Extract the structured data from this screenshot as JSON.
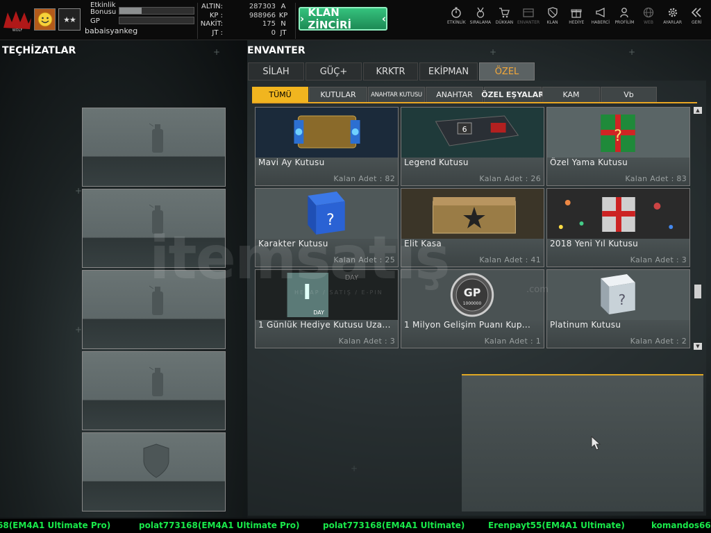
{
  "topbar": {
    "stat_labels": [
      "Etkinlik",
      "Bonusu",
      "GP"
    ],
    "username": "babaisyankeg",
    "bonus_progress": 0.3,
    "gp_progress": 0.0,
    "currency": [
      {
        "label": "ALTIN:",
        "value": "287303",
        "unit": "A"
      },
      {
        "label": "KP :",
        "value": "988966",
        "unit": "KP"
      },
      {
        "label": "NAKİT:",
        "value": "175",
        "unit": "N"
      },
      {
        "label": "JT :",
        "value": "0",
        "unit": "JT"
      }
    ],
    "klan_button": "KLAN ZİNCİRİ",
    "nav": [
      {
        "label": "ETKİNLİK",
        "icon": "stopwatch-icon"
      },
      {
        "label": "SIRALAMA",
        "icon": "medal-icon"
      },
      {
        "label": "DÜKKAN",
        "icon": "cart-icon"
      },
      {
        "label": "ENVANTER",
        "icon": "inventory-icon"
      },
      {
        "label": "KLAN",
        "icon": "shield-icon"
      },
      {
        "label": "HEDİYE",
        "icon": "gift-icon"
      },
      {
        "label": "HABERCİ",
        "icon": "megaphone-icon"
      },
      {
        "label": "PROFİLİM",
        "icon": "profile-icon"
      },
      {
        "label": "WEB",
        "icon": "globe-icon"
      },
      {
        "label": "AYARLAR",
        "icon": "gear-icon"
      },
      {
        "label": "GERİ",
        "icon": "back-icon"
      }
    ]
  },
  "left": {
    "title": "TEÇHİZATLAR"
  },
  "inventory": {
    "title": "ENVANTER",
    "tabs": [
      "SİLAH",
      "GÜÇ+",
      "KRKTR",
      "EKİPMAN",
      "ÖZEL"
    ],
    "active_tab": "ÖZEL",
    "subtabs": [
      "TÜMÜ",
      "KUTULAR",
      "ANAHTAR KUTUSU",
      "ANAHTAR",
      "ÖZEL EŞYALAR",
      "KAM",
      "Vb"
    ],
    "active_subtab": "TÜMÜ",
    "items": [
      {
        "name": "Mavi Ay Kutusu",
        "count": "Kalan Adet : 82"
      },
      {
        "name": "Legend Kutusu",
        "count": "Kalan Adet : 26"
      },
      {
        "name": "Özel Yama Kutusu",
        "count": "Kalan Adet : 83"
      },
      {
        "name": "Karakter Kutusu",
        "count": "Kalan Adet : 25"
      },
      {
        "name": "Elit Kasa",
        "count": "Kalan Adet : 41"
      },
      {
        "name": "2018 Yeni Yıl Kutusu",
        "count": "Kalan Adet : 3"
      },
      {
        "name": "1 Günlük Hediye Kutusu Uza...",
        "count": "Kalan Adet : 3"
      },
      {
        "name": "1 Milyon Gelişim Puanı Kup...",
        "count": "Kalan Adet : 1"
      },
      {
        "name": "Platinum Kutusu",
        "count": "Kalan Adet : 2"
      }
    ],
    "item_art": {
      "day_top": "DAY",
      "day_bottom": "DAY",
      "day_number": "1",
      "gp_label": "GP",
      "gp_amount": "1000000"
    }
  },
  "watermark": {
    "main": "itemsatış",
    "dotcom": ".com",
    "sub": "HESAP / SATIŞ / E-PIN"
  },
  "ticker": [
    "68(EM4A1 Ultimate Pro)",
    "polat773168(EM4A1 Ultimate Pro)",
    "polat773168(EM4A1 Ultimate)",
    "Erenpayt55(EM4A1 Ultimate)",
    "komandos66("
  ]
}
